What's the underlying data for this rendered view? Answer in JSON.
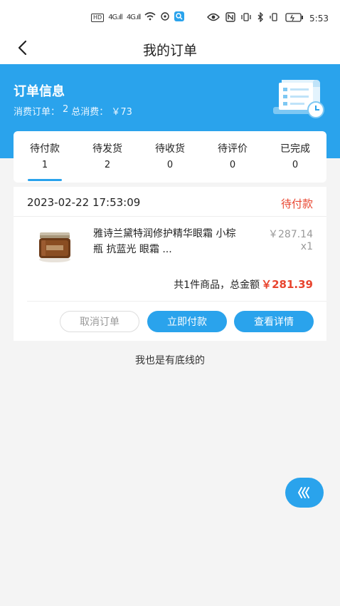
{
  "status_bar": {
    "left_chip_1": "HD",
    "left_chip_2": "HD",
    "signal_1": "4G.ıll",
    "signal_2": "4G.ıll",
    "time": "5:53"
  },
  "navbar": {
    "title": "我的订单"
  },
  "banner": {
    "title": "订单信息",
    "consumed_orders_label": "消费订单：",
    "consumed_orders_value": "2",
    "total_spent_label": "总消费：",
    "total_spent_value": "￥73"
  },
  "tabs": [
    {
      "label": "待付款",
      "count": "1"
    },
    {
      "label": "待发货",
      "count": "2"
    },
    {
      "label": "待收货",
      "count": "0"
    },
    {
      "label": "待评价",
      "count": "0"
    },
    {
      "label": "已完成",
      "count": "0"
    }
  ],
  "order": {
    "time": "2023-02-22 17:53:09",
    "status": "待付款",
    "product_name": "雅诗兰黛特润修护精华眼霜 小棕瓶 抗蓝光 眼霜 ...",
    "unit_price": "￥287.14",
    "quantity": "x1",
    "summary_label": "共1件商品，总金额",
    "total_amount": "￥281.39",
    "buttons": {
      "cancel": "取消订单",
      "pay": "立即付款",
      "detail": "查看详情"
    }
  },
  "footer_text": "我也是有底线的",
  "colors": {
    "accent": "#2aa3ec",
    "alert": "#e8452f",
    "muted": "#999999"
  }
}
